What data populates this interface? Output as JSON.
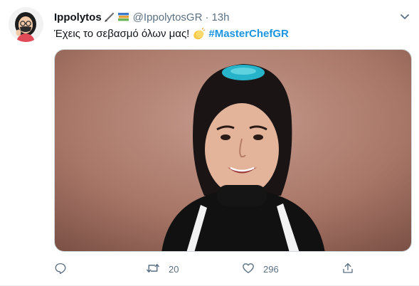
{
  "tweet": {
    "display_name": "Ippolytos",
    "name_emojis": [
      "paintbrush-icon",
      "books-icon"
    ],
    "handle": "@IppolytosGR",
    "separator": "·",
    "time": "13h",
    "text": "Έχεις το σεβασμό όλων μας!",
    "text_emoji": "clapping-hands-icon",
    "hashtag": "#MasterChefGR",
    "actions": {
      "reply_count": "",
      "retweet_count": "20",
      "like_count": "296"
    }
  },
  "colors": {
    "text": "#0f1419",
    "secondary": "#5b7083",
    "link": "#1b95e0",
    "border": "#e6ecf0"
  }
}
